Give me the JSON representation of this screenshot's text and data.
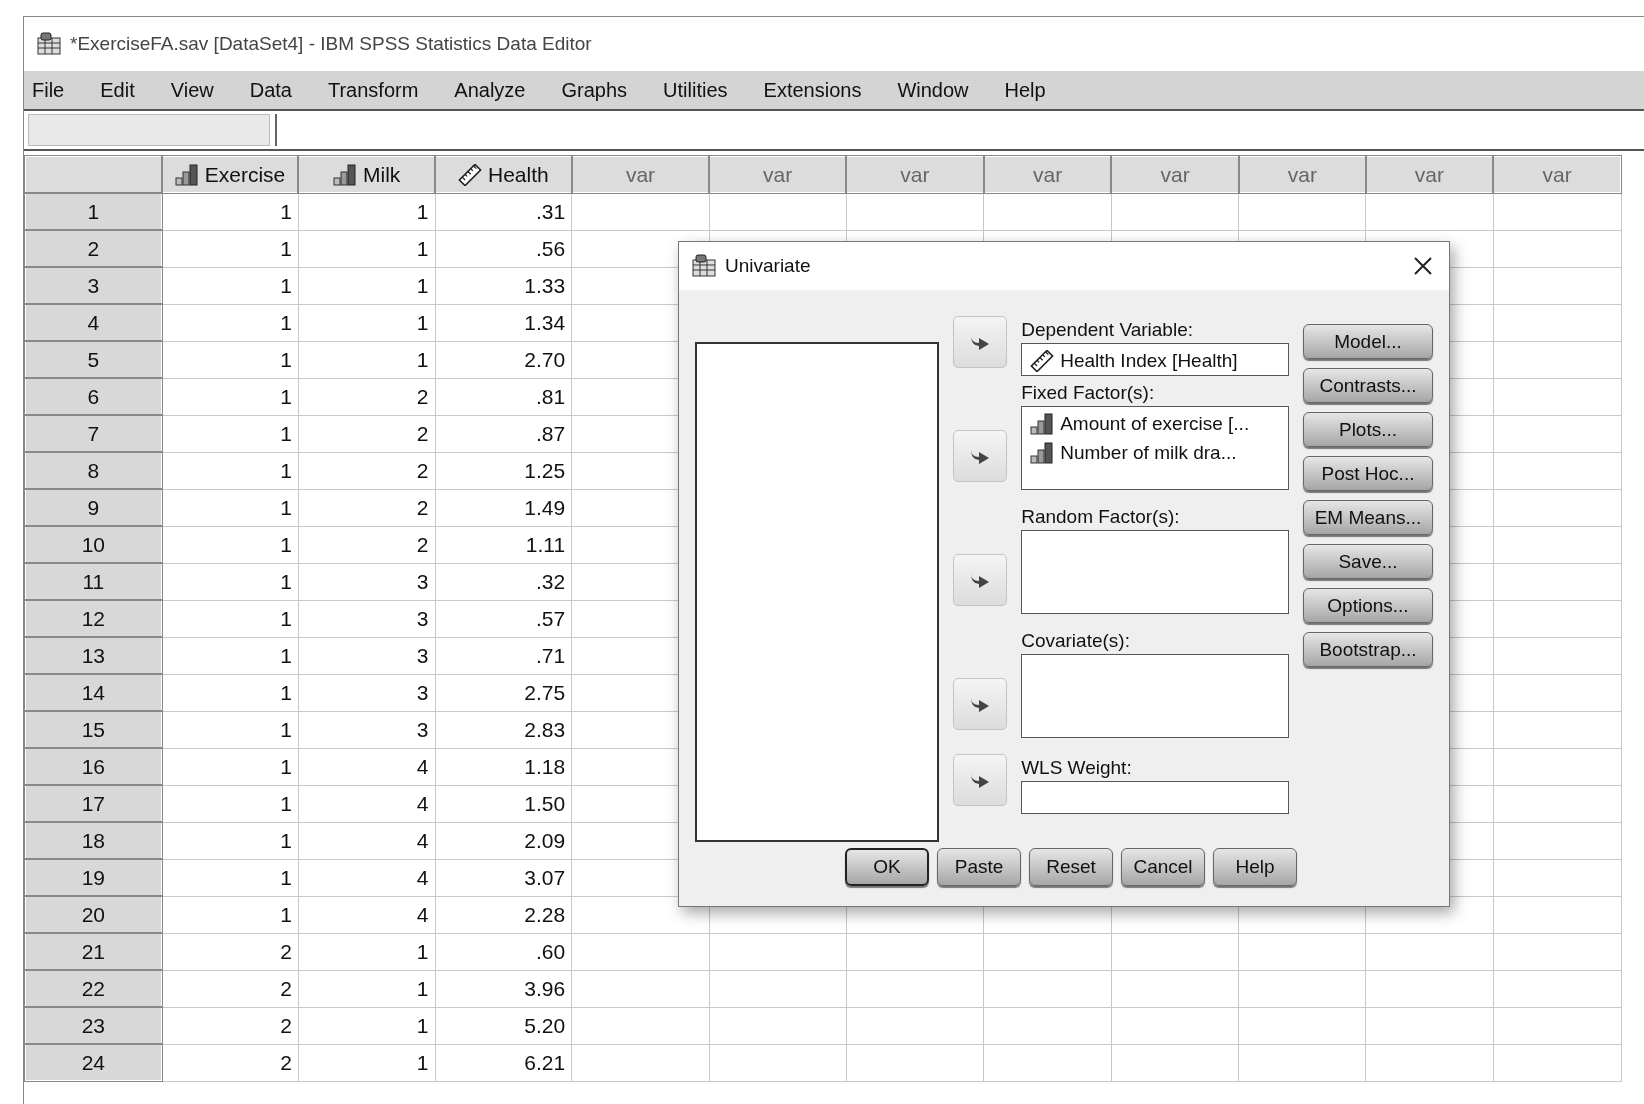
{
  "window": {
    "title": "*ExerciseFA.sav [DataSet4] - IBM SPSS Statistics Data Editor"
  },
  "menu": [
    "File",
    "Edit",
    "View",
    "Data",
    "Transform",
    "Analyze",
    "Graphs",
    "Utilities",
    "Extensions",
    "Window",
    "Help"
  ],
  "grid": {
    "columns": [
      {
        "label": "Exercise",
        "kind": "nominal"
      },
      {
        "label": "Milk",
        "kind": "nominal"
      },
      {
        "label": "Health",
        "kind": "scale"
      },
      {
        "label": "var",
        "kind": "empty"
      },
      {
        "label": "var",
        "kind": "empty"
      },
      {
        "label": "var",
        "kind": "empty"
      },
      {
        "label": "var",
        "kind": "empty"
      },
      {
        "label": "var",
        "kind": "empty"
      },
      {
        "label": "var",
        "kind": "empty"
      },
      {
        "label": "var",
        "kind": "empty"
      },
      {
        "label": "var",
        "kind": "empty"
      }
    ],
    "rows": [
      {
        "number": "1",
        "cells": [
          "1",
          "1",
          ".31"
        ]
      },
      {
        "number": "2",
        "cells": [
          "1",
          "1",
          ".56"
        ]
      },
      {
        "number": "3",
        "cells": [
          "1",
          "1",
          "1.33"
        ]
      },
      {
        "number": "4",
        "cells": [
          "1",
          "1",
          "1.34"
        ]
      },
      {
        "number": "5",
        "cells": [
          "1",
          "1",
          "2.70"
        ]
      },
      {
        "number": "6",
        "cells": [
          "1",
          "2",
          ".81"
        ]
      },
      {
        "number": "7",
        "cells": [
          "1",
          "2",
          ".87"
        ]
      },
      {
        "number": "8",
        "cells": [
          "1",
          "2",
          "1.25"
        ]
      },
      {
        "number": "9",
        "cells": [
          "1",
          "2",
          "1.49"
        ]
      },
      {
        "number": "10",
        "cells": [
          "1",
          "2",
          "1.11"
        ]
      },
      {
        "number": "11",
        "cells": [
          "1",
          "3",
          ".32"
        ]
      },
      {
        "number": "12",
        "cells": [
          "1",
          "3",
          ".57"
        ]
      },
      {
        "number": "13",
        "cells": [
          "1",
          "3",
          ".71"
        ]
      },
      {
        "number": "14",
        "cells": [
          "1",
          "3",
          "2.75"
        ]
      },
      {
        "number": "15",
        "cells": [
          "1",
          "3",
          "2.83"
        ]
      },
      {
        "number": "16",
        "cells": [
          "1",
          "4",
          "1.18"
        ]
      },
      {
        "number": "17",
        "cells": [
          "1",
          "4",
          "1.50"
        ]
      },
      {
        "number": "18",
        "cells": [
          "1",
          "4",
          "2.09"
        ]
      },
      {
        "number": "19",
        "cells": [
          "1",
          "4",
          "3.07"
        ]
      },
      {
        "number": "20",
        "cells": [
          "1",
          "4",
          "2.28"
        ]
      },
      {
        "number": "21",
        "cells": [
          "2",
          "1",
          ".60"
        ]
      },
      {
        "number": "22",
        "cells": [
          "2",
          "1",
          "3.96"
        ]
      },
      {
        "number": "23",
        "cells": [
          "2",
          "1",
          "5.20"
        ]
      },
      {
        "number": "24",
        "cells": [
          "2",
          "1",
          "6.21"
        ]
      }
    ]
  },
  "dialog": {
    "title": "Univariate",
    "targets": [
      {
        "label": "Dependent Variable:",
        "kind": "single",
        "items": [
          {
            "text": "Health Index [Health]",
            "kind": "scale"
          }
        ]
      },
      {
        "label": "Fixed Factor(s):",
        "kind": "list",
        "items": [
          {
            "text": "Amount of exercise [...",
            "kind": "nominal"
          },
          {
            "text": "Number of milk dra...",
            "kind": "nominal"
          }
        ]
      },
      {
        "label": "Random Factor(s):",
        "kind": "list"
      },
      {
        "label": "Covariate(s):",
        "kind": "list"
      },
      {
        "label": "WLS Weight:",
        "kind": "single"
      }
    ],
    "side_buttons": [
      "Model...",
      "Contrasts...",
      "Plots...",
      "Post Hoc...",
      "EM Means...",
      "Save...",
      "Options...",
      "Bootstrap..."
    ],
    "bottom_buttons": [
      {
        "label": "OK",
        "default": true
      },
      {
        "label": "Paste",
        "default": false
      },
      {
        "label": "Reset",
        "default": false
      },
      {
        "label": "Cancel",
        "default": false
      },
      {
        "label": "Help",
        "default": false
      }
    ]
  }
}
